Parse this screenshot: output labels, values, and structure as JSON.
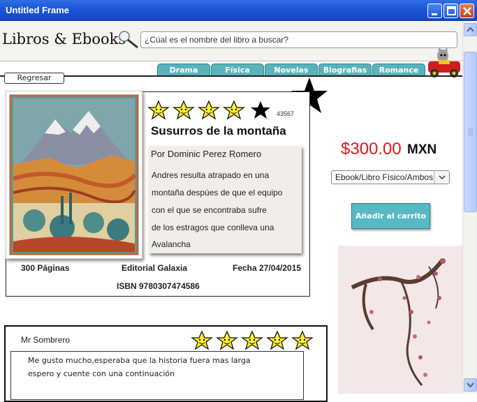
{
  "window": {
    "title": "Untitled Frame"
  },
  "header": {
    "logo_text": "Libros & Ebooks",
    "search_placeholder": "¿Cúal es el nombre del libro a buscar?"
  },
  "tabs": [
    "Drama",
    "Física",
    "Novelas",
    "Biografias",
    "Romance"
  ],
  "back_label": "Regresar",
  "book": {
    "rating_stars": 4,
    "rating_max": 5,
    "rating_count": "43567",
    "title": "Susurros de la montaña",
    "author": "Por Dominic Perez Romero",
    "description_lines": [
      "Andres resulta atrapado en una",
      "montaña despúes de que el equipo",
      "con el que se encontraba sufre",
      "de los estragos que conlleva una",
      "Avalancha"
    ],
    "pages": "300 Páginas",
    "publisher": "Editorial Galaxia",
    "date": "Fecha 27/04/2015",
    "isbn": "ISBN 9780307474586"
  },
  "purchase": {
    "price": "$300.00",
    "currency": "MXN",
    "format_selected": "Ebook/Libro Físico/Ambos",
    "add_to_cart_label": "Añadir al carrito"
  },
  "review": {
    "reviewer": "Mr Sombrero",
    "rating_stars": 5,
    "lines": [
      "Me gusto mucho,esperaba que la historia fuera mas larga",
      "espero y cuente con una continuación"
    ]
  },
  "colors": {
    "tab": "#5ab3bb",
    "price": "#e0161c",
    "star_fill": "#ffee33",
    "cart_button": "#56b9c4"
  }
}
